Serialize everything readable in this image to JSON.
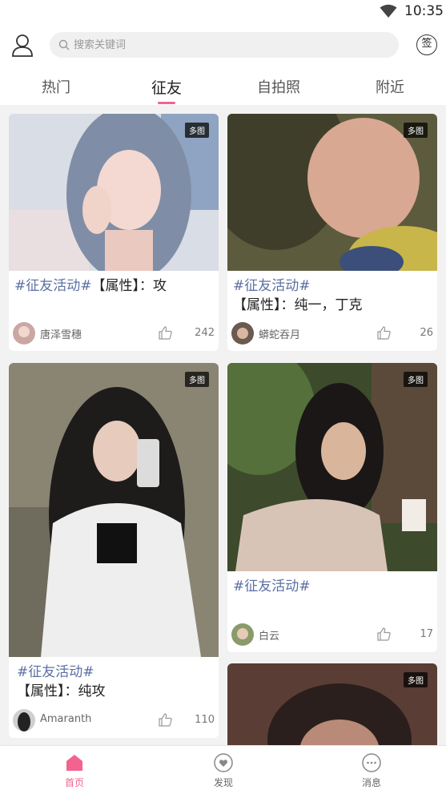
{
  "status_bar": {
    "time": "10:35"
  },
  "header": {
    "search_placeholder": "搜索关键词",
    "checkin_label": "签",
    "tabs": [
      "热门",
      "征友",
      "自拍照",
      "附近"
    ],
    "active_tab": "征友"
  },
  "posts": [
    {
      "badge": "多图",
      "tag": "#征友活动#",
      "text": "【属性】：攻",
      "author": "唐泽雪穗",
      "likes": "242"
    },
    {
      "badge": "多图",
      "tag": "#征友活动#",
      "text": "【属性】：纯一，丁克",
      "author": "蟒蛇吞月",
      "likes": "26"
    },
    {
      "badge": "多图",
      "tag": "#征友活动#",
      "text": "【属性】：纯攻",
      "author": "Amaranth",
      "likes": "110"
    },
    {
      "badge": "多图",
      "tag": "#征友活动#",
      "text": "",
      "author": "白云",
      "likes": "17"
    },
    {
      "badge": "多图"
    }
  ],
  "bottom_nav": [
    {
      "label": "首页",
      "active": true
    },
    {
      "label": "发现",
      "active": false
    },
    {
      "label": "消息",
      "active": false
    }
  ],
  "colors": {
    "accent": "#f2638f",
    "tag": "#5b6fa3"
  }
}
